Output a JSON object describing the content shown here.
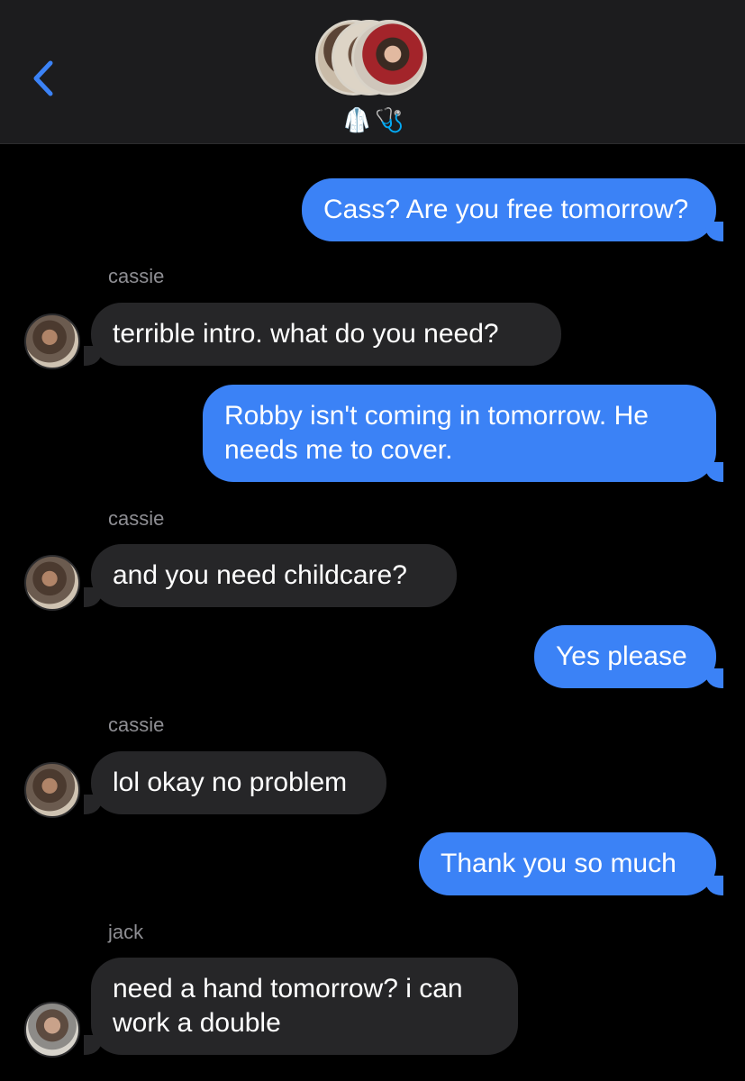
{
  "header": {
    "group_emoji": [
      "🥼",
      "🩺"
    ],
    "colors": {
      "bar": "#1c1c1e",
      "back_arrow": "#3b82f6"
    },
    "icons": {
      "back": "chevron-left-icon"
    }
  },
  "messages": [
    {
      "from": "me",
      "text": "Cass? Are you free tomorrow?"
    },
    {
      "from": "cassie",
      "sender_label": "cassie",
      "text": "terrible intro. what do you need?"
    },
    {
      "from": "me",
      "text": "Robby isn't coming in tomorrow. He needs me to cover."
    },
    {
      "from": "cassie",
      "sender_label": "cassie",
      "text": "and you need childcare?"
    },
    {
      "from": "me",
      "text": "Yes please"
    },
    {
      "from": "cassie",
      "sender_label": "cassie",
      "text": "lol okay no problem"
    },
    {
      "from": "me",
      "text": "Thank you so much"
    },
    {
      "from": "jack",
      "sender_label": "jack",
      "text": "need a hand tomorrow? i can work a double"
    }
  ],
  "colors": {
    "outgoing": "#3b82f6",
    "incoming": "#262628",
    "sender_label": "#8e8e93",
    "background": "#000000"
  }
}
